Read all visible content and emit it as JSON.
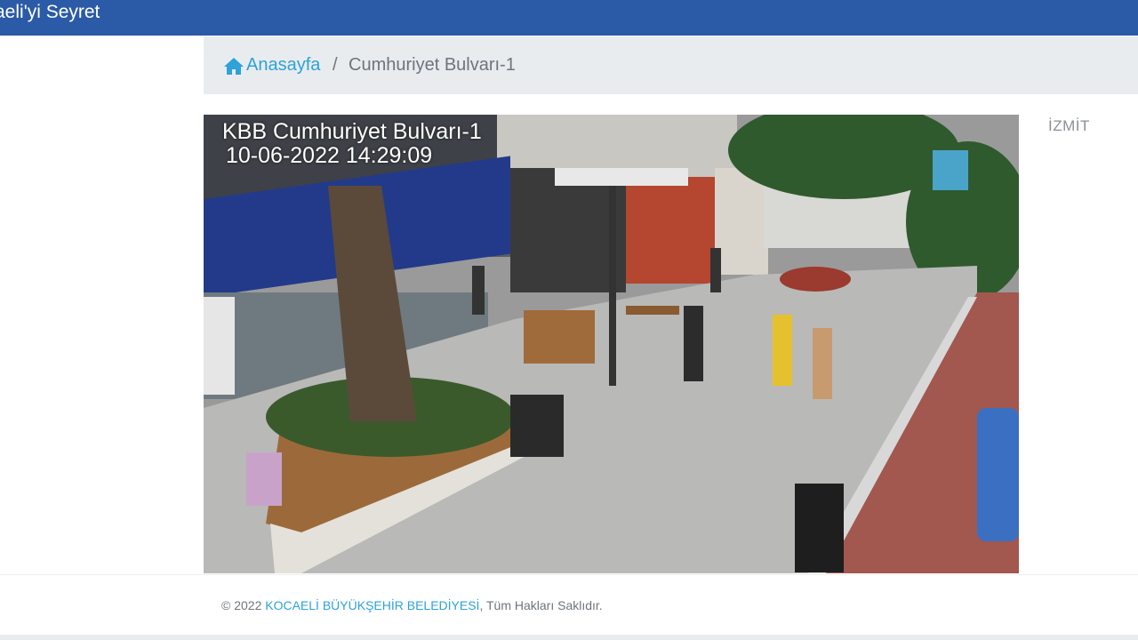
{
  "header": {
    "title": "aeli'yi Seyret"
  },
  "breadcrumb": {
    "home_label": "Anasayfa",
    "separator": "/",
    "current": "Cumhuriyet Bulvarı-1"
  },
  "camera": {
    "overlay_title": "KBB Cumhuriyet Bulvarı-1",
    "overlay_timestamp": "10-06-2022 14:29:09"
  },
  "sidebar": {
    "district": "İZMİT"
  },
  "footer": {
    "copyright_prefix": "© 2022",
    "org_link": "KOCAELİ BÜYÜKŞEHİR BELEDİYESİ",
    "rights_suffix": ", Tüm Hakları Saklıdır."
  },
  "colors": {
    "header_bg": "#2b5aa6",
    "link": "#2ea2d9",
    "breadcrumb_bg": "#e9ecef"
  },
  "icons": {
    "breadcrumb_home": "home-icon"
  }
}
